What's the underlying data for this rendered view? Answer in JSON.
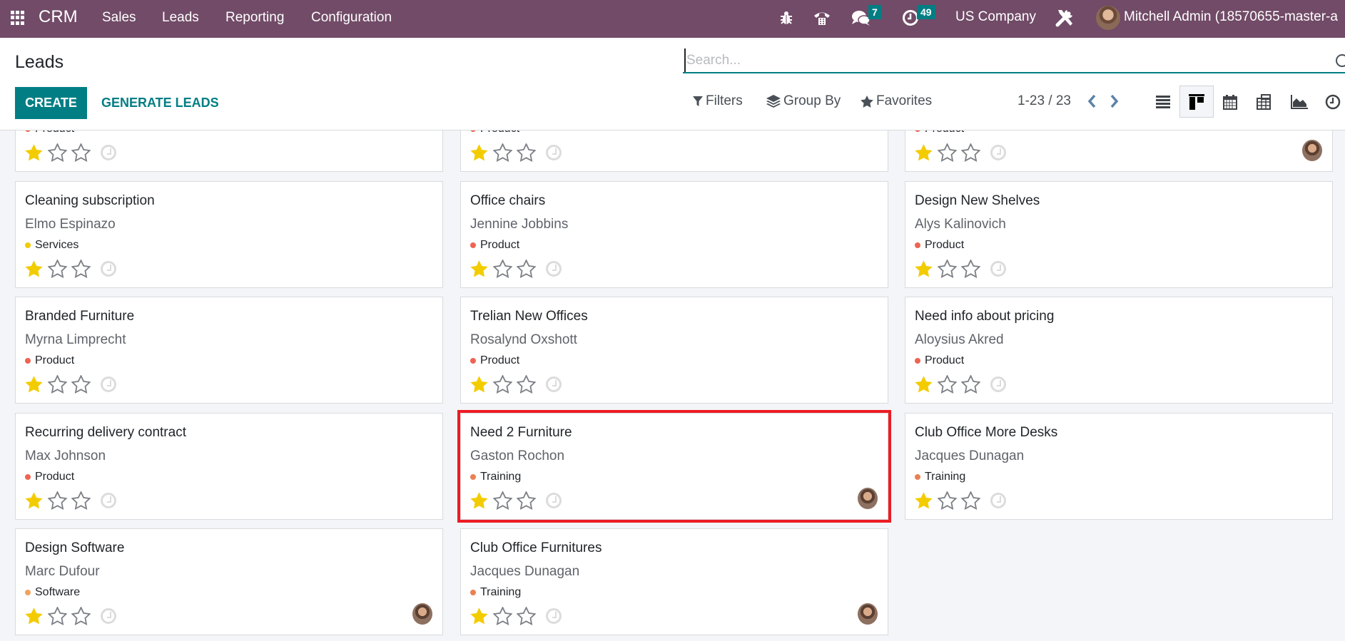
{
  "navbar": {
    "app_name": "CRM",
    "menu": [
      "Sales",
      "Leads",
      "Reporting",
      "Configuration"
    ],
    "messages_badge": "7",
    "activities_badge": "49",
    "company": "US Company",
    "user": "Mitchell Admin (18570655-master-a",
    "icons": [
      "apps-grid-icon",
      "bug-icon",
      "phone-icon",
      "chat-icon",
      "clock-icon",
      "tools-icon"
    ]
  },
  "control_panel": {
    "title": "Leads",
    "create_label": "CREATE",
    "generate_label": "GENERATE LEADS",
    "search_placeholder": "Search...",
    "search_value": "",
    "filters_label": "Filters",
    "groupby_label": "Group By",
    "favorites_label": "Favorites",
    "pager": "1-23 / 23",
    "views": [
      "list",
      "kanban",
      "calendar",
      "pivot",
      "graph",
      "activity"
    ],
    "active_view": "kanban"
  },
  "colors": {
    "brand": "#714b67",
    "primary": "#017e84",
    "highlight": "#ed1c24",
    "star_filled": "#f3cc00",
    "tag_product": "#ee6451",
    "tag_services": "#f3cc00",
    "tag_training": "#e98152",
    "tag_software": "#f0a35c"
  },
  "partial_row": [
    {
      "tag": "Product",
      "tag_color": "#ee6451",
      "priority": 1,
      "has_avatar": false
    },
    {
      "tag": "Product",
      "tag_color": "#ee6451",
      "priority": 1,
      "has_avatar": false
    },
    {
      "tag": "Product",
      "tag_color": "#ee6451",
      "priority": 1,
      "has_avatar": true
    }
  ],
  "leads": [
    {
      "title": "Cleaning subscription",
      "contact": "Elmo Espinazo",
      "tag": "Services",
      "tag_color": "#f3cc00",
      "priority": 1,
      "has_avatar": false,
      "highlighted": false
    },
    {
      "title": "Office chairs",
      "contact": "Jennine Jobbins",
      "tag": "Product",
      "tag_color": "#ee6451",
      "priority": 1,
      "has_avatar": false,
      "highlighted": false
    },
    {
      "title": "Design New Shelves",
      "contact": "Alys Kalinovich",
      "tag": "Product",
      "tag_color": "#ee6451",
      "priority": 1,
      "has_avatar": false,
      "highlighted": false
    },
    {
      "title": "Branded Furniture",
      "contact": "Myrna Limprecht",
      "tag": "Product",
      "tag_color": "#ee6451",
      "priority": 1,
      "has_avatar": false,
      "highlighted": false
    },
    {
      "title": "Trelian New Offices",
      "contact": "Rosalynd Oxshott",
      "tag": "Product",
      "tag_color": "#ee6451",
      "priority": 1,
      "has_avatar": false,
      "highlighted": false
    },
    {
      "title": "Need info about pricing",
      "contact": "Aloysius Akred",
      "tag": "Product",
      "tag_color": "#ee6451",
      "priority": 1,
      "has_avatar": false,
      "highlighted": false
    },
    {
      "title": "Recurring delivery contract",
      "contact": "Max Johnson",
      "tag": "Product",
      "tag_color": "#ee6451",
      "priority": 1,
      "has_avatar": false,
      "highlighted": false
    },
    {
      "title": "Need 2 Furniture",
      "contact": "Gaston Rochon",
      "tag": "Training",
      "tag_color": "#e98152",
      "priority": 1,
      "has_avatar": true,
      "highlighted": true
    },
    {
      "title": "Club Office More Desks",
      "contact": "Jacques Dunagan",
      "tag": "Training",
      "tag_color": "#e98152",
      "priority": 1,
      "has_avatar": false,
      "highlighted": false
    },
    {
      "title": "Design Software",
      "contact": "Marc Dufour",
      "tag": "Software",
      "tag_color": "#f0a35c",
      "priority": 1,
      "has_avatar": true,
      "highlighted": false
    },
    {
      "title": "Club Office Furnitures",
      "contact": "Jacques Dunagan",
      "tag": "Training",
      "tag_color": "#e98152",
      "priority": 1,
      "has_avatar": true,
      "highlighted": false
    }
  ]
}
